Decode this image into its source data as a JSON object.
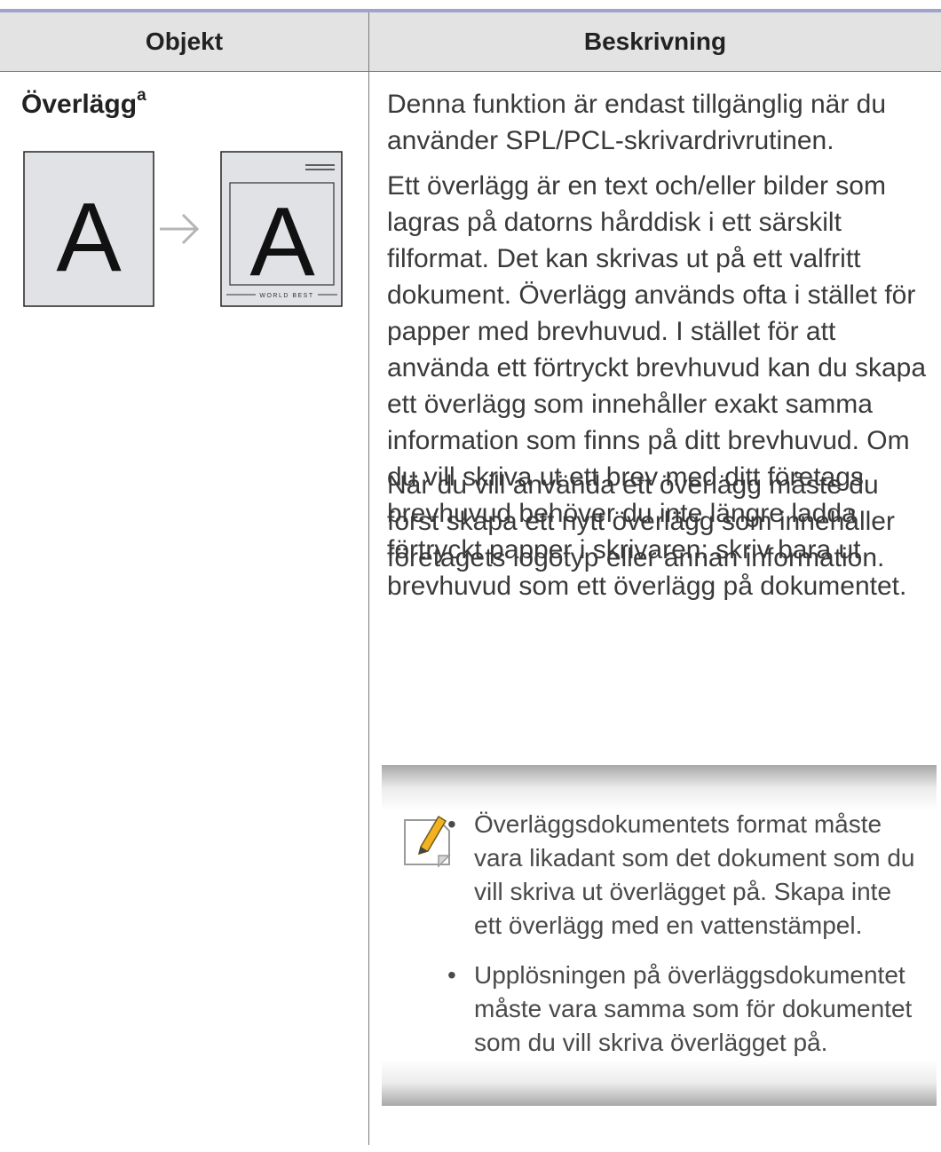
{
  "table": {
    "headers": {
      "object": "Objekt",
      "description": "Beskrivning"
    },
    "row": {
      "item_name": "Överlägg",
      "item_footnote": "a",
      "illustration": {
        "before_letter": "A",
        "after_letter": "A",
        "footer_text": "WORLD BEST",
        "arrow_icon": "right-arrow-icon"
      },
      "paragraphs": [
        "Denna funktion är endast tillgänglig när du använder SPL/PCL-skrivardrivrutinen.",
        "Ett överlägg är en text och/eller bilder som lagras på datorns hårddisk i ett särskilt filformat. Det kan skrivas ut på ett valfritt dokument. Överlägg används ofta i stället för papper med brevhuvud. I stället för att använda ett förtryckt brevhuvud kan du skapa ett överlägg som innehåller exakt samma information som finns på ditt brevhuvud. Om du vill skriva ut ett brev med ditt företags brevhuvud behöver du inte längre ladda förtryckt papper i skrivaren: skriv bara ut brevhuvud som ett överlägg på dokumentet.",
        "När du vill använda ett överlägg måste du först skapa ett nytt överlägg som innehåller företagets logotyp eller annan information."
      ],
      "note": {
        "icon": "note-pencil-icon",
        "bullet": "•",
        "items": [
          "Överläggsdokumentets format måste vara likadant som det dokument som du vill skriva ut överlägget på. Skapa inte ett överlägg med en vattenstämpel.",
          "Upplösningen på överläggsdokumentet måste vara samma som för dokumentet som du vill skriva överlägget på."
        ]
      }
    }
  },
  "colors": {
    "header_bg": "#e3e3e3",
    "top_rule": "#9ea5c8",
    "text": "#3a3a3a",
    "page_bg": "#e0e2e5"
  }
}
